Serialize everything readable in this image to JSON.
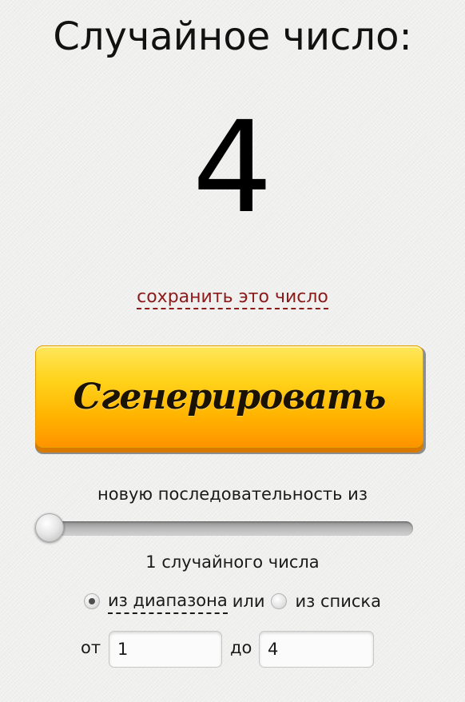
{
  "title": "Случайное число:",
  "result": {
    "value": "4",
    "save_link": "сохранить это число"
  },
  "generate_button": {
    "label": "Сгенерировать"
  },
  "sequence": {
    "label": "новую последовательность из",
    "count_label": "1 случайного числа",
    "slider_position": 0
  },
  "mode": {
    "range_label": "из диапазона",
    "or_label": "или",
    "list_label": "из списка",
    "selected": "range"
  },
  "range": {
    "from_label": "от",
    "from_value": "1",
    "to_label": "до",
    "to_value": "4"
  },
  "colors": {
    "link": "#8b1a1a",
    "button_top": "#ffe65a",
    "button_bottom": "#ff9300"
  }
}
